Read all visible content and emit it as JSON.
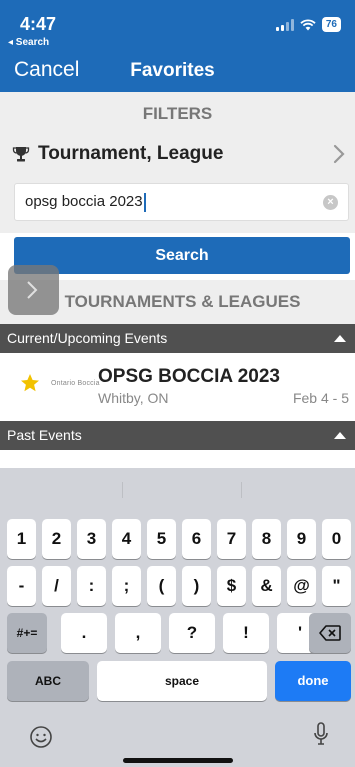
{
  "status": {
    "time": "4:47",
    "back_label": "◂ Search",
    "battery": "76"
  },
  "nav": {
    "cancel_label": "Cancel",
    "title": "Favorites"
  },
  "filters": {
    "header": "FILTERS",
    "type_label": "Tournament, League",
    "search_value": "opsg boccia 2023",
    "search_button": "Search"
  },
  "results": {
    "header": "TOURNAMENTS & LEAGUES",
    "current_section": "Current/Upcoming Events",
    "past_section": "Past Events",
    "events": [
      {
        "name": "OPSG BOCCIA 2023",
        "location": "Whitby, ON",
        "date": "Feb 4 - 5",
        "logo_text": "Ontario Boccia"
      }
    ]
  },
  "keyboard": {
    "row1": [
      "1",
      "2",
      "3",
      "4",
      "5",
      "6",
      "7",
      "8",
      "9",
      "0"
    ],
    "row2": [
      "-",
      "/",
      ":",
      ";",
      "(",
      ")",
      "$",
      "&",
      "@",
      "\""
    ],
    "row3_left": "#+=",
    "row3": [
      ".",
      ",",
      "?",
      "!",
      "'"
    ],
    "abc": "ABC",
    "space": "space",
    "done": "done"
  },
  "icons": {
    "trophy": "trophy-icon",
    "chevron": "chevron-right-icon",
    "star": "star-icon",
    "clear": "clear-icon",
    "backspace": "backspace-icon",
    "emoji": "emoji-icon",
    "mic": "microphone-icon"
  },
  "colors": {
    "brand_blue": "#1e6bb8",
    "section_dark": "#505050",
    "star": "#f2c200",
    "done_key": "#1d7bf5"
  }
}
